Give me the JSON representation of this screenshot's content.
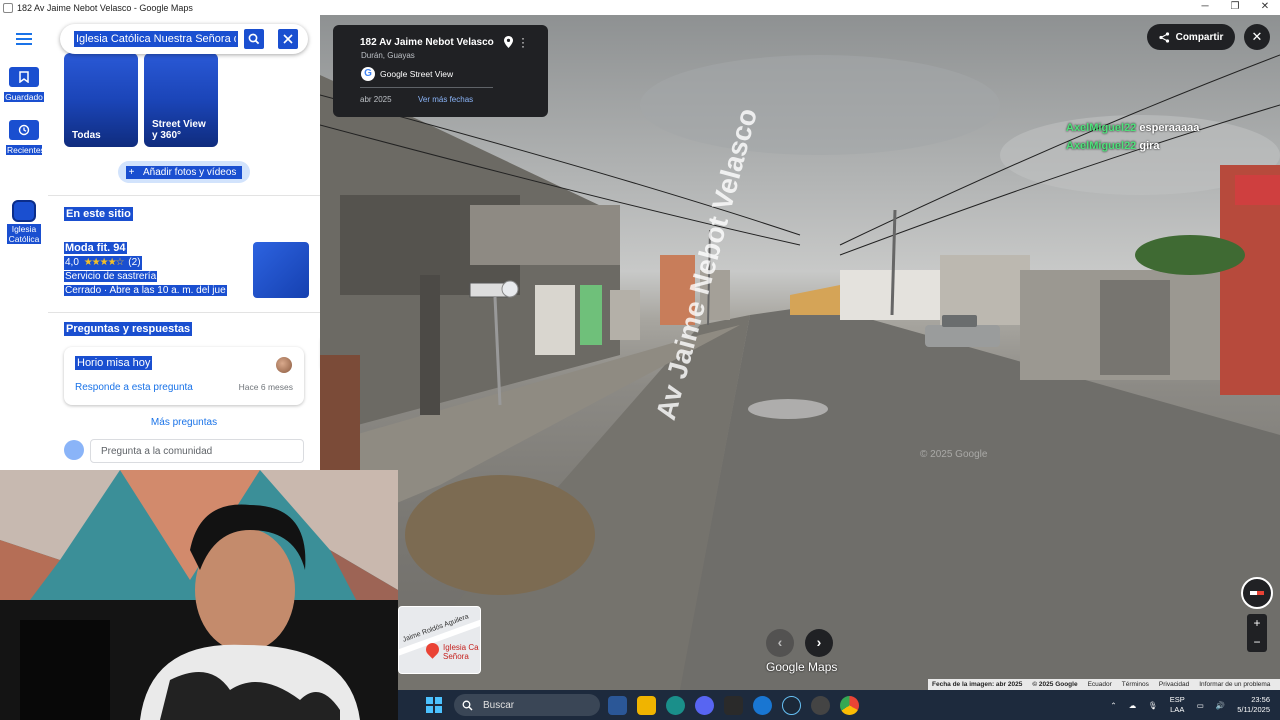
{
  "window": {
    "title": "182 Av Jaime Nebot Velasco - Google Maps",
    "controls": [
      "─",
      "❐",
      "✕"
    ]
  },
  "rail": {
    "items": [
      {
        "label": "Guardado",
        "icon": "bookmark-icon"
      },
      {
        "label": "Recientes",
        "icon": "history-icon"
      },
      {
        "label": "Iglesia Católica",
        "icon": "place-thumbnail"
      }
    ]
  },
  "search": {
    "value": "Iglesia Católica Nuestra Señora de L"
  },
  "photos": {
    "tiles": [
      {
        "label": "Todas"
      },
      {
        "label": "Street View y 360°"
      }
    ],
    "add_label": "Añadir fotos y vídeos"
  },
  "sections": {
    "on_site": "En este sitio",
    "qa": "Preguntas y respuestas"
  },
  "business": {
    "name": "Moda fit. 94",
    "rating": "4,0",
    "stars": "★★★★☆",
    "reviews": "(2)",
    "category": "Servicio de sastrería",
    "hours": "Cerrado · Abre a las 10 a. m. del jue"
  },
  "question": {
    "text": "Horio misa hoy",
    "answer_link": "Responde a esta pregunta",
    "age": "Hace 6 meses"
  },
  "more_questions": "Más preguntas",
  "ask": {
    "placeholder": "Pregunta a la comunidad"
  },
  "streetview": {
    "address": "182 Av Jaime Nebot Velasco",
    "locality": "Durán, Guayas",
    "provider": "Google Street View",
    "date": "abr 2025",
    "more_dates": "Ver más fechas",
    "share_label": "Compartir",
    "road_text": "Av Jaime Nebot Velasco",
    "watermark": "© 2025 Google",
    "logo": "Google Maps",
    "footer": [
      "Fecha de la imagen: abr 2025",
      "© 2025 Google",
      "Ecuador",
      "Términos",
      "Privacidad",
      "Informar de un problema"
    ]
  },
  "chat": [
    {
      "user": "AxelMiguel22",
      "message": "esperaaaaa"
    },
    {
      "user": "AxelMiguel22",
      "message": "gira"
    }
  ],
  "minimap": {
    "road": "Jaime Roldós Aguilera",
    "place": "Iglesia Ca Señora"
  },
  "taskbar": {
    "search_label": "Buscar",
    "lang": "ESP",
    "layout": "LAA",
    "time": "23:56",
    "date": "5/11/2025"
  },
  "colors": {
    "selection": "#1a4fd0",
    "link": "#1a73e8",
    "dark_overlay": "#202124",
    "taskbar": "#1d2a3d"
  }
}
